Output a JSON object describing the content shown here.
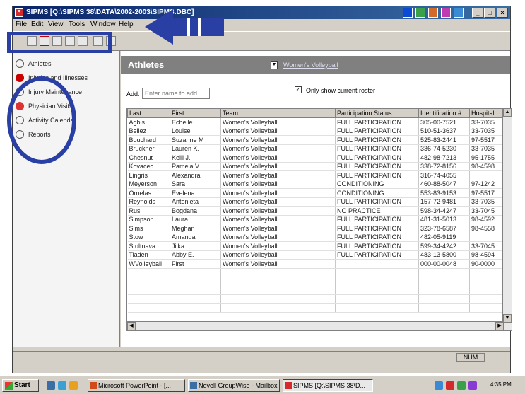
{
  "window": {
    "title": "SIPMS [Q:\\SIPMS 38\\DATA\\2002-2003\\SIPMS.DBC]"
  },
  "menu": [
    "File",
    "Edit",
    "View",
    "Tools",
    "Window",
    "Help"
  ],
  "sidebar": {
    "items": [
      {
        "label": "Athletes",
        "icon": "person-icon"
      },
      {
        "label": "Injuries and Illnesses",
        "icon": "injury-icon"
      },
      {
        "label": "Injury Maintenance",
        "icon": "maintenance-icon"
      },
      {
        "label": "Physician Visits",
        "icon": "physician-icon"
      },
      {
        "label": "Activity Calendar",
        "icon": "calendar-icon"
      },
      {
        "label": "Reports",
        "icon": "reports-icon"
      }
    ]
  },
  "header": {
    "title": "Athletes",
    "team_link": "Women's Volleyball"
  },
  "add": {
    "label": "Add:",
    "placeholder": "Enter name to add"
  },
  "roster_checkbox": {
    "label": "Only show current roster",
    "checked": true
  },
  "table": {
    "columns": [
      "Last",
      "First",
      "Team",
      "Participation Status",
      "Identification #",
      "Hospital"
    ],
    "rows": [
      [
        "Agbis",
        "Echelle",
        "Women's Volleyball",
        "FULL PARTICIPATION",
        "305-00-7521",
        "33-7035"
      ],
      [
        "Bellez",
        "Louise",
        "Women's Volleyball",
        "FULL PARTICIPATION",
        "510-51-3637",
        "33-7035"
      ],
      [
        "Bouchard",
        "Suzanne M",
        "Women's Volleyball",
        "FULL PARTICIPATION",
        "525-83-2441",
        "97-5517"
      ],
      [
        "Bruckner",
        "Lauren K.",
        "Women's Volleyball",
        "FULL PARTICIPATION",
        "336-74-5230",
        "33-7035"
      ],
      [
        "Chesnut",
        "Kelli J.",
        "Women's Volleyball",
        "FULL PARTICIPATION",
        "482-98-7213",
        "95-1755"
      ],
      [
        "Kovacec",
        "Pamela V.",
        "Women's Volleyball",
        "FULL PARTICIPATION",
        "338-72-8156",
        "98-4598"
      ],
      [
        "Lingris",
        "Alexandra",
        "Women's Volleyball",
        "FULL PARTICIPATION",
        "316-74-4055",
        ""
      ],
      [
        "Meyerson",
        "Sara",
        "Women's Volleyball",
        "CONDITIONING",
        "460-88-5047",
        "97-1242"
      ],
      [
        "Ornelas",
        "Evelena",
        "Women's Volleyball",
        "CONDITIONING",
        "553-83-9153",
        "97-5517"
      ],
      [
        "Reynolds",
        "Antonieta",
        "Women's Volleyball",
        "FULL PARTICIPATION",
        "157-72-9481",
        "33-7035"
      ],
      [
        "Rus",
        "Bogdana",
        "Women's Volleyball",
        "NO PRACTICE",
        "598-34-4247",
        "33-7045"
      ],
      [
        "Simpson",
        "Laura",
        "Women's Volleyball",
        "FULL PARTICIPATION",
        "481-31-5013",
        "98-4592"
      ],
      [
        "Sims",
        "Meghan",
        "Women's Volleyball",
        "FULL PARTICIPATION",
        "323-78-6587",
        "98-4558"
      ],
      [
        "Stow",
        "Amanda",
        "Women's Volleyball",
        "FULL PARTICIPATION",
        "482-05-9119",
        ""
      ],
      [
        "Stoltnava",
        "Jilka",
        "Women's Volleyball",
        "FULL PARTICIPATION",
        "599-34-4242",
        "33-7045"
      ],
      [
        "Tiaden",
        "Abby E.",
        "Women's Volleyball",
        "FULL PARTICIPATION",
        "483-13-5800",
        "98-4594"
      ],
      [
        "WVolleyball",
        "First",
        "Women's Volleyball",
        "",
        "000-00-0048",
        "90-0000"
      ]
    ]
  },
  "status": {
    "num": "NUM"
  },
  "taskbar": {
    "start": "Start",
    "tasks": [
      "Microsoft PowerPoint - [...",
      "Novell GroupWise - Mailbox",
      "SIPMS [Q:\\SIPMS 38\\D..."
    ],
    "clock": "4:35 PM"
  },
  "colors": {
    "annotation": "#2a3fa4",
    "titlebar": "#0a246a",
    "header": "#808080"
  }
}
